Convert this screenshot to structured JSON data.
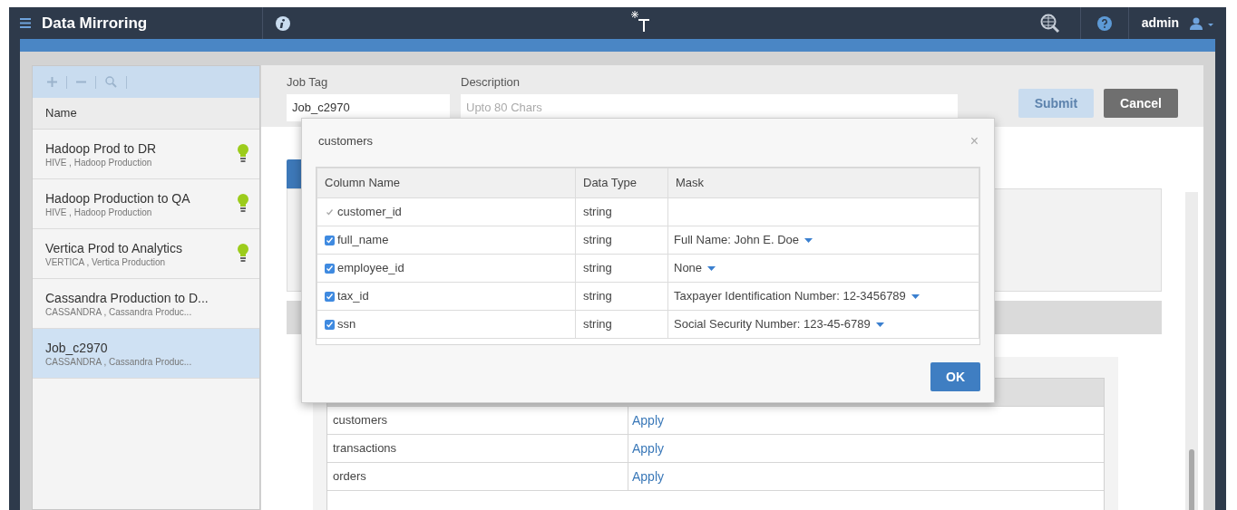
{
  "header": {
    "title": "Data Mirroring",
    "user": "admin"
  },
  "jobs": {
    "columns": [
      "Name"
    ],
    "items": [
      {
        "name": "Hadoop Prod to DR",
        "source": "HIVE , Hadoop Production",
        "active": true,
        "selected": false
      },
      {
        "name": "Hadoop Production to QA",
        "source": "HIVE , Hadoop Production",
        "active": true,
        "selected": false
      },
      {
        "name": "Vertica Prod to Analytics",
        "source": "VERTICA , Vertica Production",
        "active": true,
        "selected": false
      },
      {
        "name": "Cassandra Production to D...",
        "source": "CASSANDRA , Cassandra Produc...",
        "active": false,
        "selected": false
      },
      {
        "name": "Job_c2970",
        "source": "CASSANDRA , Cassandra Produc...",
        "active": false,
        "selected": true
      }
    ]
  },
  "form": {
    "job_tag": {
      "label": "Job Tag",
      "value": "Job_c2970"
    },
    "description": {
      "label": "Description",
      "placeholder": "Upto 80 Chars"
    },
    "buttons": [
      {
        "kind": "primary",
        "label": "Submit",
        "disabled": true
      },
      {
        "kind": "secondary",
        "label": "Cancel",
        "disabled": false
      }
    ]
  },
  "tables": {
    "rows": [
      {
        "name": "customers",
        "action": "Apply"
      },
      {
        "name": "transactions",
        "action": "Apply"
      },
      {
        "name": "orders",
        "action": "Apply"
      }
    ]
  },
  "modal": {
    "title": "customers",
    "close": "×",
    "columns": [
      "Column Name",
      "Data Type",
      "Mask"
    ],
    "rows": [
      {
        "name": "customer_id",
        "checked": true,
        "disabled": true,
        "type": "string"
      },
      {
        "name": "full_name",
        "checked": true,
        "disabled": false,
        "type": "string",
        "mask": "Full Name: John E. Doe"
      },
      {
        "name": "employee_id",
        "checked": true,
        "disabled": false,
        "type": "string",
        "mask": "None"
      },
      {
        "name": "tax_id",
        "checked": true,
        "disabled": false,
        "type": "string",
        "mask": "Taxpayer Identification Number: 12-3456789"
      },
      {
        "name": "ssn",
        "checked": true,
        "disabled": false,
        "type": "string",
        "mask": "Social Security Number: 123-45-6789"
      }
    ],
    "ok": "OK"
  }
}
